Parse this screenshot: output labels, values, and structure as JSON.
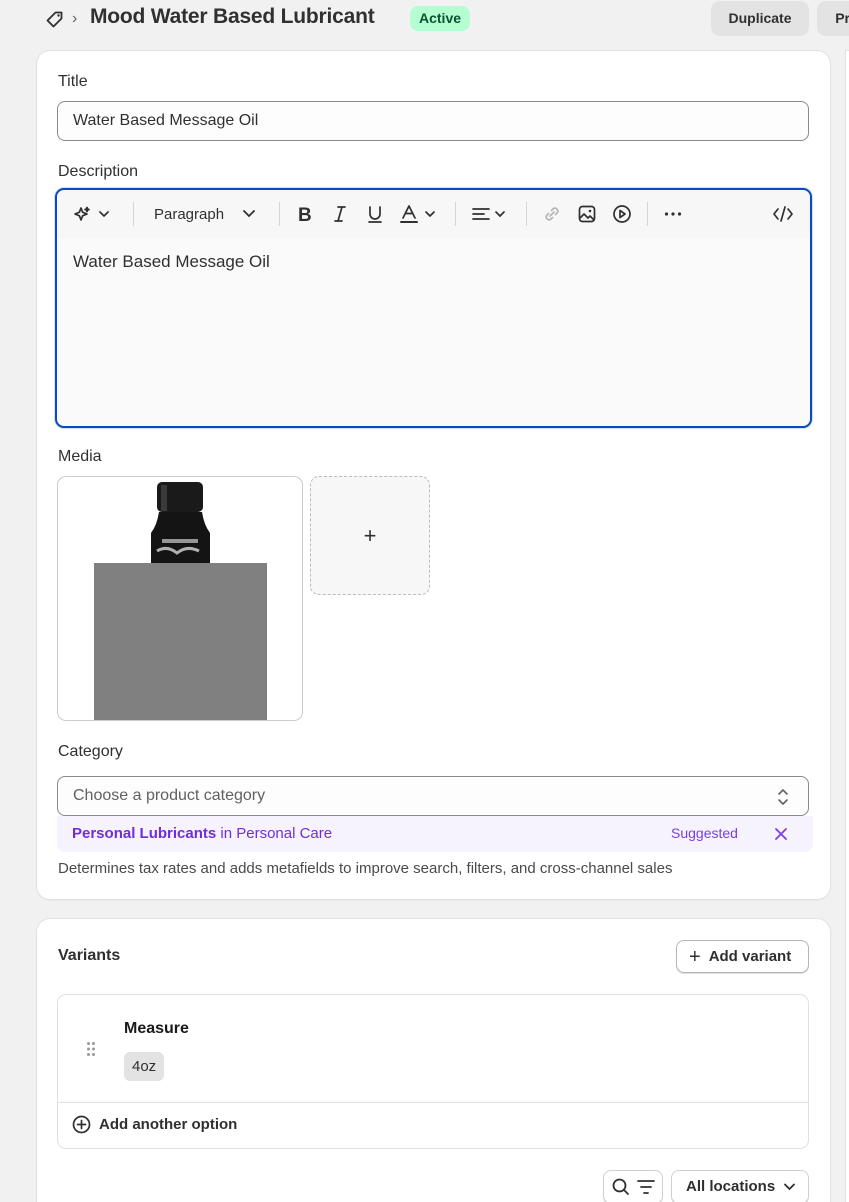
{
  "header": {
    "title": "Mood Water Based Lubricant",
    "status": "Active",
    "duplicate_label": "Duplicate",
    "preview_label": "Pre",
    "icons": {
      "product": "tag-icon",
      "breadcrumb": "chevron-right-icon"
    }
  },
  "product": {
    "title_label": "Title",
    "title_value": "Water Based Message Oil",
    "description_label": "Description",
    "description_value": "Water Based Message Oil",
    "editor": {
      "paragraph_label": "Paragraph",
      "tools": [
        "magic-icon",
        "bold-icon",
        "italic-icon",
        "underline-icon",
        "text-color-icon",
        "align-icon",
        "link-icon",
        "image-icon",
        "video-icon",
        "more-icon",
        "code-icon"
      ]
    },
    "media_label": "Media",
    "media_add_symbol": "+",
    "category_label": "Category",
    "category_placeholder": "Choose a product category",
    "suggestion": {
      "category": "Personal Lubricants",
      "connector": "in Personal Care",
      "tag": "Suggested"
    },
    "category_help": "Determines tax rates and adds metafields to improve search, filters, and cross-channel sales"
  },
  "variants": {
    "title": "Variants",
    "add_variant_label": "Add variant",
    "option_name": "Measure",
    "option_values": [
      "4oz"
    ],
    "add_option_label": "Add another option",
    "locations_label": "All locations"
  },
  "colors": {
    "accent": "#0a4bbf",
    "status_bg": "#b4fed2",
    "status_text": "#0c5132",
    "suggestion": "#6f2ed8"
  }
}
